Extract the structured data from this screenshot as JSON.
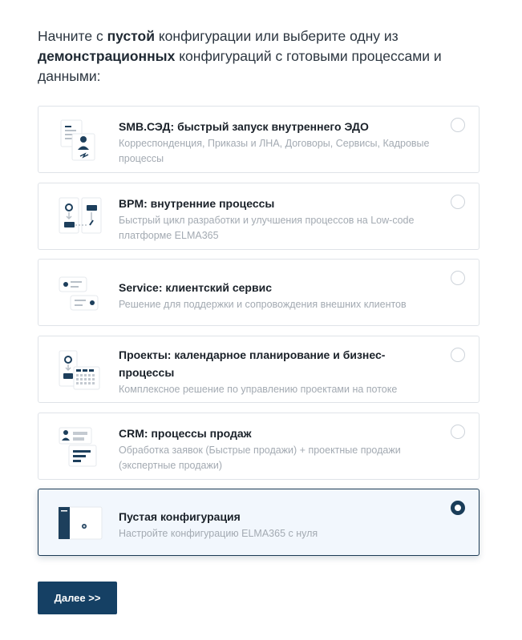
{
  "intro": {
    "part1": "Начните с ",
    "bold1": "пустой",
    "part2": " конфигурации или выберите одну из ",
    "bold2": "демонстрационных",
    "part3": " конфигураций с готовыми процессами и данными:"
  },
  "options": [
    {
      "title": "SMB.СЭД: быстрый запуск внутреннего ЭДО",
      "description": "Корреспонденция, Приказы и ЛНА, Договоры, Сервисы, Кадровые процессы",
      "icon": "document-signature-icon"
    },
    {
      "title": "BPM: внутренние процессы",
      "description": "Быстрый цикл разработки и улучшения процессов на Low-code платформе ELMA365",
      "icon": "process-flow-icon"
    },
    {
      "title": "Service: клиентский сервис",
      "description": "Решение для поддержки и сопровождения внешних клиентов",
      "icon": "chat-bubbles-icon"
    },
    {
      "title": "Проекты: календарное планирование и бизнес-процессы",
      "description": "Комплексное решение по управлению проектами на потоке",
      "icon": "project-calendar-icon"
    },
    {
      "title": "CRM: процессы продаж",
      "description": "Обработка заявок (Быстрые продажи) + проектные продажи (экспертные продажи)",
      "icon": "crm-contact-icon"
    },
    {
      "title": "Пустая конфигурация",
      "description": "Настройте конфигурацию ELMA365 с нуля",
      "icon": "blank-config-icon"
    }
  ],
  "selected_index": 5,
  "next_button": {
    "label": "Далее >>"
  },
  "colors": {
    "accent": "#154064",
    "selected_border": "#1c3b55",
    "selected_bg": "#f2f7fd",
    "description_text": "#a3aab2"
  }
}
